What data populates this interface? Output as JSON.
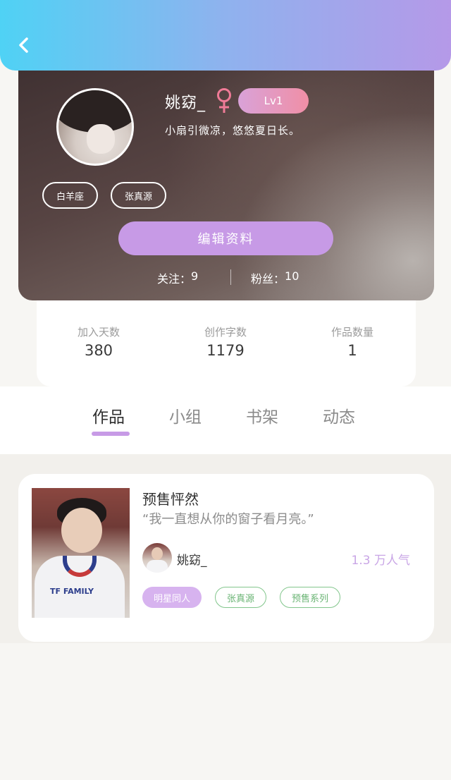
{
  "header": {
    "back_icon": "chevron-left-icon"
  },
  "profile": {
    "username": "姚窈_",
    "gender_symbol": "♀",
    "level": "Lv1",
    "bio": "小扇引微凉，悠悠夏日长。",
    "tags": [
      "白羊座",
      "张真源"
    ],
    "edit_button": "编辑资料",
    "following_label": "关注：",
    "following_count": "9",
    "followers_label": "粉丝：",
    "followers_count": "10"
  },
  "stats": [
    {
      "label": "加入天数",
      "value": "380"
    },
    {
      "label": "创作字数",
      "value": "1179"
    },
    {
      "label": "作品数量",
      "value": "1"
    }
  ],
  "tabs": [
    {
      "label": "作品",
      "active": true
    },
    {
      "label": "小组",
      "active": false
    },
    {
      "label": "书架",
      "active": false
    },
    {
      "label": "动态",
      "active": false
    }
  ],
  "works": [
    {
      "title": "预售怦然",
      "quote": "“我一直想从你的窗子看月亮。”",
      "cover_jersey": "TF FAMILY",
      "author": "姚窈_",
      "popularity": "1.3 万人气",
      "tags": [
        "明星同人",
        "张真源",
        "预售系列"
      ]
    }
  ],
  "colors": {
    "accent_purple": "#c79ae6",
    "header_gradient_start": "#4fd2f5",
    "header_gradient_end": "#b599e8",
    "tag_green": "#82c68c"
  }
}
